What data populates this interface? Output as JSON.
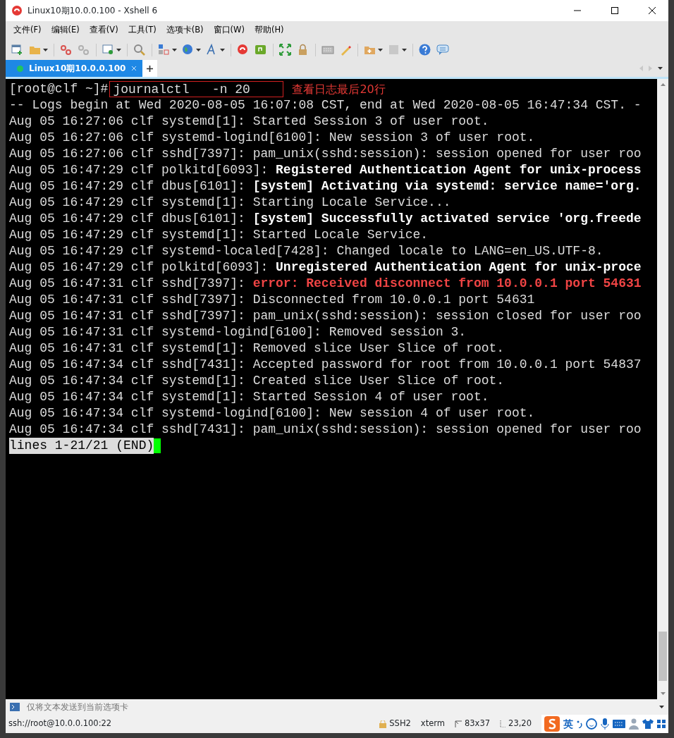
{
  "window": {
    "title": "Linux10期10.0.0.100 - Xshell 6"
  },
  "menu": [
    "文件(F)",
    "编辑(E)",
    "查看(V)",
    "工具(T)",
    "选项卡(B)",
    "窗口(W)",
    "帮助(H)"
  ],
  "toolbar": [
    {
      "kind": "new",
      "dropdown": false
    },
    {
      "kind": "folder",
      "dropdown": true
    },
    {
      "kind": "sep"
    },
    {
      "kind": "unlink",
      "dropdown": false
    },
    {
      "kind": "link",
      "dropdown": false
    },
    {
      "kind": "sep"
    },
    {
      "kind": "window",
      "dropdown": true
    },
    {
      "kind": "sep"
    },
    {
      "kind": "search",
      "dropdown": false
    },
    {
      "kind": "sep"
    },
    {
      "kind": "layout",
      "dropdown": true
    },
    {
      "kind": "globe",
      "dropdown": true
    },
    {
      "kind": "font",
      "dropdown": true
    },
    {
      "kind": "sep"
    },
    {
      "kind": "shell",
      "dropdown": false
    },
    {
      "kind": "ftp",
      "dropdown": false
    },
    {
      "kind": "sep"
    },
    {
      "kind": "fullscreen",
      "dropdown": false
    },
    {
      "kind": "lock",
      "dropdown": false
    },
    {
      "kind": "sep"
    },
    {
      "kind": "keyboard",
      "dropdown": false
    },
    {
      "kind": "pen",
      "dropdown": false
    },
    {
      "kind": "sep"
    },
    {
      "kind": "addfolder",
      "dropdown": true
    },
    {
      "kind": "panel",
      "dropdown": true
    },
    {
      "kind": "sep"
    },
    {
      "kind": "help",
      "dropdown": false
    },
    {
      "kind": "chat",
      "dropdown": false
    }
  ],
  "tabs": [
    {
      "label": "Linux10期10.0.0.100",
      "selected": true,
      "connected": true
    }
  ],
  "terminal": {
    "prompt": "[root@clf ~]#",
    "command": "journalctl   -n 20",
    "note": "查看日志最后20行",
    "lines": [
      {
        "segments": [
          {
            "text": "-- Logs begin at Wed 2020-08-05 16:07:08 CST, end at Wed 2020-08-05 16:47:34 CST. -",
            "kind": "plain"
          }
        ]
      },
      {
        "segments": [
          {
            "text": "Aug 05 16:27:06 clf systemd[1]: ",
            "kind": "plain"
          },
          {
            "text": "Started Session 3 of user root.",
            "kind": "plain"
          }
        ]
      },
      {
        "segments": [
          {
            "text": "Aug 05 16:27:06 clf systemd-logind[6100]: ",
            "kind": "plain"
          },
          {
            "text": "New session 3 of user root.",
            "kind": "plain"
          }
        ]
      },
      {
        "segments": [
          {
            "text": "Aug 05 16:27:06 clf sshd[7397]: ",
            "kind": "plain"
          },
          {
            "text": "pam_unix(sshd:session): session opened for user roo",
            "kind": "plain"
          }
        ]
      },
      {
        "segments": [
          {
            "text": "Aug 05 16:47:29 clf polkitd[6093]: ",
            "kind": "plain"
          },
          {
            "text": "Registered Authentication Agent for unix-process",
            "kind": "bold"
          }
        ]
      },
      {
        "segments": [
          {
            "text": "Aug 05 16:47:29 clf dbus[6101]: ",
            "kind": "plain"
          },
          {
            "text": "[system] Activating via systemd: service name='org.",
            "kind": "bold"
          }
        ]
      },
      {
        "segments": [
          {
            "text": "Aug 05 16:47:29 clf systemd[1]: ",
            "kind": "plain"
          },
          {
            "text": "Starting Locale Service...",
            "kind": "plain"
          }
        ]
      },
      {
        "segments": [
          {
            "text": "Aug 05 16:47:29 clf dbus[6101]: ",
            "kind": "plain"
          },
          {
            "text": "[system] Successfully activated service 'org.freede",
            "kind": "bold"
          }
        ]
      },
      {
        "segments": [
          {
            "text": "Aug 05 16:47:29 clf systemd[1]: ",
            "kind": "plain"
          },
          {
            "text": "Started Locale Service.",
            "kind": "plain"
          }
        ]
      },
      {
        "segments": [
          {
            "text": "Aug 05 16:47:29 clf systemd-localed[7428]: ",
            "kind": "plain"
          },
          {
            "text": "Changed locale to LANG=en_US.UTF-8.",
            "kind": "plain"
          }
        ]
      },
      {
        "segments": [
          {
            "text": "Aug 05 16:47:29 clf polkitd[6093]: ",
            "kind": "plain"
          },
          {
            "text": "Unregistered Authentication Agent for unix-proce",
            "kind": "bold"
          }
        ]
      },
      {
        "segments": [
          {
            "text": "Aug 05 16:47:31 clf sshd[7397]: ",
            "kind": "plain"
          },
          {
            "text": "error: Received disconnect from 10.0.0.1 port 54631",
            "kind": "error"
          }
        ]
      },
      {
        "segments": [
          {
            "text": "Aug 05 16:47:31 clf sshd[7397]: ",
            "kind": "plain"
          },
          {
            "text": "Disconnected from 10.0.0.1 port 54631",
            "kind": "plain"
          }
        ]
      },
      {
        "segments": [
          {
            "text": "Aug 05 16:47:31 clf sshd[7397]: ",
            "kind": "plain"
          },
          {
            "text": "pam_unix(sshd:session): session closed for user roo",
            "kind": "plain"
          }
        ]
      },
      {
        "segments": [
          {
            "text": "Aug 05 16:47:31 clf systemd-logind[6100]: ",
            "kind": "plain"
          },
          {
            "text": "Removed session 3.",
            "kind": "plain"
          }
        ]
      },
      {
        "segments": [
          {
            "text": "Aug 05 16:47:31 clf systemd[1]: ",
            "kind": "plain"
          },
          {
            "text": "Removed slice User Slice of root.",
            "kind": "plain"
          }
        ]
      },
      {
        "segments": [
          {
            "text": "Aug 05 16:47:34 clf sshd[7431]: ",
            "kind": "plain"
          },
          {
            "text": "Accepted password for root from 10.0.0.1 port 54837",
            "kind": "plain"
          }
        ]
      },
      {
        "segments": [
          {
            "text": "Aug 05 16:47:34 clf systemd[1]: ",
            "kind": "plain"
          },
          {
            "text": "Created slice User Slice of root.",
            "kind": "plain"
          }
        ]
      },
      {
        "segments": [
          {
            "text": "Aug 05 16:47:34 clf systemd[1]: ",
            "kind": "plain"
          },
          {
            "text": "Started Session 4 of user root.",
            "kind": "plain"
          }
        ]
      },
      {
        "segments": [
          {
            "text": "Aug 05 16:47:34 clf systemd-logind[6100]: ",
            "kind": "plain"
          },
          {
            "text": "New session 4 of user root.",
            "kind": "plain"
          }
        ]
      },
      {
        "segments": [
          {
            "text": "Aug 05 16:47:34 clf sshd[7431]: ",
            "kind": "plain"
          },
          {
            "text": "pam_unix(sshd:session): session opened for user roo",
            "kind": "plain"
          }
        ]
      }
    ],
    "pager": "lines 1-21/21 (END)"
  },
  "compose": {
    "placeholder": "仅将文本发送到当前选项卡"
  },
  "status_bar": {
    "address": "ssh://root@10.0.0.100:22",
    "protocol": "SSH2",
    "terminal_type": "xterm",
    "size": "83x37",
    "cursor": "23,20",
    "ime": "英"
  }
}
